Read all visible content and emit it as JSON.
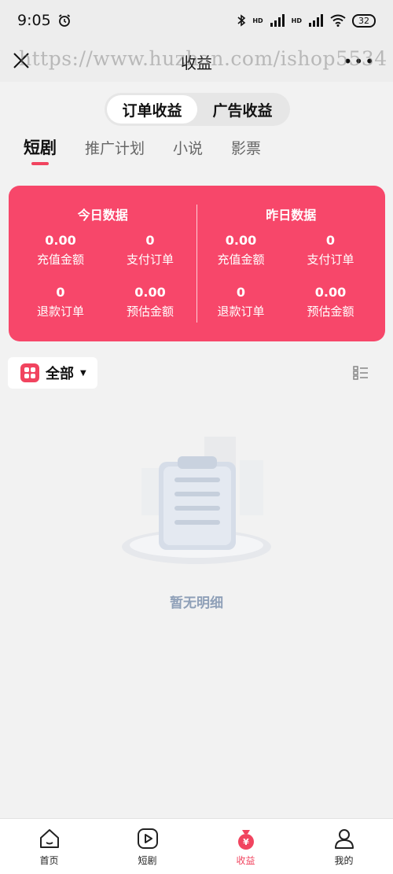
{
  "status_bar": {
    "time": "9:05",
    "battery": "32",
    "hd1": "HD",
    "hd2": "HD"
  },
  "nav": {
    "title": "收益",
    "more": "•••"
  },
  "watermark": "https://www.huzhan.com/ishop5534",
  "segments": [
    {
      "label": "订单收益",
      "active": true
    },
    {
      "label": "广告收益",
      "active": false
    }
  ],
  "tabs": [
    {
      "label": "短剧",
      "active": true
    },
    {
      "label": "推广计划",
      "active": false
    },
    {
      "label": "小说",
      "active": false
    },
    {
      "label": "影票",
      "active": false
    }
  ],
  "stats": {
    "today": {
      "title": "今日数据",
      "recharge_amount": {
        "value": "0.00",
        "label": "充值金额"
      },
      "paid_orders": {
        "value": "0",
        "label": "支付订单"
      },
      "refund_orders": {
        "value": "0",
        "label": "退款订单"
      },
      "estimated_amount": {
        "value": "0.00",
        "label": "预估金额"
      }
    },
    "yesterday": {
      "title": "昨日数据",
      "recharge_amount": {
        "value": "0.00",
        "label": "充值金额"
      },
      "paid_orders": {
        "value": "0",
        "label": "支付订单"
      },
      "refund_orders": {
        "value": "0",
        "label": "退款订单"
      },
      "estimated_amount": {
        "value": "0.00",
        "label": "预估金额"
      }
    }
  },
  "filter": {
    "label": "全部"
  },
  "empty_state": {
    "text": "暂无明细"
  },
  "bottom_nav": [
    {
      "label": "首页",
      "icon": "home-icon",
      "active": false
    },
    {
      "label": "短剧",
      "icon": "play-icon",
      "active": false
    },
    {
      "label": "收益",
      "icon": "money-bag-icon",
      "active": true
    },
    {
      "label": "我的",
      "icon": "user-icon",
      "active": false
    }
  ],
  "colors": {
    "accent": "#f1445f",
    "card": "#f7476a",
    "background": "#f2f2f2",
    "empty_text": "#8fa0b8"
  }
}
